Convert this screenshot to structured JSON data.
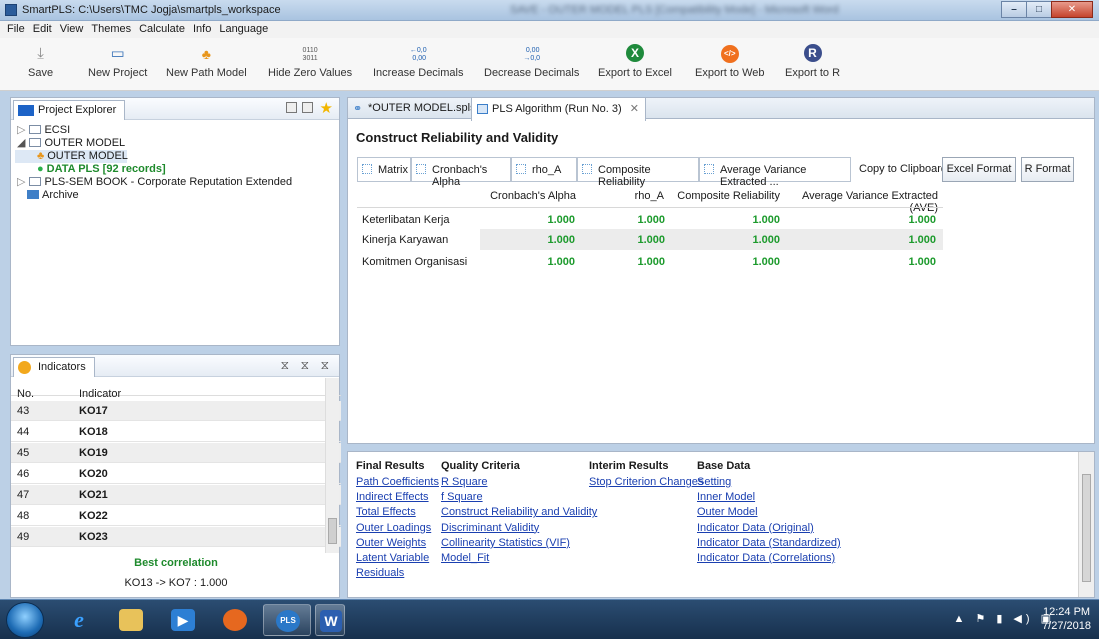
{
  "window": {
    "title": "SmartPLS: C:\\Users\\TMC Jogja\\smartpls_workspace",
    "blurred_title": "SAVE - OUTER MODEL PLS [Compatibility Mode] - Microsoft Word"
  },
  "menu": [
    "File",
    "Edit",
    "View",
    "Themes",
    "Calculate",
    "Info",
    "Language"
  ],
  "toolbar": [
    {
      "label": "Save",
      "icon": "save-icon"
    },
    {
      "label": "New Project",
      "icon": "new-project-icon"
    },
    {
      "label": "New Path Model",
      "icon": "path-model-icon"
    },
    {
      "label": "Hide Zero Values",
      "icon": "binary-icon",
      "glyph": "0110\n3011"
    },
    {
      "label": "Increase Decimals",
      "icon": "increase-decimals-icon",
      "glyph": "←0,0\n0,00"
    },
    {
      "label": "Decrease Decimals",
      "icon": "decrease-decimals-icon",
      "glyph": "0,00\n→0,0"
    },
    {
      "label": "Export to Excel",
      "icon": "excel-icon",
      "glyph": "X"
    },
    {
      "label": "Export to Web",
      "icon": "web-icon",
      "glyph": "</>"
    },
    {
      "label": "Export to R",
      "icon": "r-icon",
      "glyph": "R"
    }
  ],
  "project_explorer": {
    "tab": "Project Explorer",
    "items": [
      {
        "label": "ECSI"
      },
      {
        "label": "OUTER MODEL"
      },
      {
        "label": "OUTER MODEL"
      },
      {
        "label": "DATA PLS [92 records]"
      },
      {
        "label": "PLS-SEM BOOK - Corporate Reputation Extended"
      },
      {
        "label": "Archive"
      }
    ]
  },
  "indicators": {
    "tab": "Indicators",
    "col_no": "No.",
    "col_indicator": "Indicator",
    "rows": [
      {
        "no": "43",
        "name": "KO17"
      },
      {
        "no": "44",
        "name": "KO18"
      },
      {
        "no": "45",
        "name": "KO19"
      },
      {
        "no": "46",
        "name": "KO20"
      },
      {
        "no": "47",
        "name": "KO21"
      },
      {
        "no": "48",
        "name": "KO22"
      },
      {
        "no": "49",
        "name": "KO23"
      }
    ],
    "best_label": "Best correlation",
    "best_value": "KO13 -> KO7 : 1.000"
  },
  "editor_tabs": [
    {
      "label": "*OUTER MODEL.splsm"
    },
    {
      "label": "PLS Algorithm (Run No. 3)"
    }
  ],
  "report": {
    "title": "Construct Reliability and Validity",
    "subtabs": [
      "Matrix",
      "Cronbach's Alpha",
      "rho_A",
      "Composite Reliability",
      "Average Variance Extracted ..."
    ],
    "copy_label": "Copy to Clipboard:",
    "excel_btn": "Excel Format",
    "r_btn": "R Format",
    "columns": [
      "Cronbach's Alpha",
      "rho_A",
      "Composite Reliability",
      "Average Variance Extracted (AVE)"
    ],
    "rows": [
      {
        "name": "Keterlibatan Kerja",
        "values": [
          "1.000",
          "1.000",
          "1.000",
          "1.000"
        ]
      },
      {
        "name": "Kinerja Karyawan",
        "values": [
          "1.000",
          "1.000",
          "1.000",
          "1.000"
        ]
      },
      {
        "name": "Komitmen Organisasi",
        "values": [
          "1.000",
          "1.000",
          "1.000",
          "1.000"
        ]
      }
    ],
    "value_color": "#1c9a2c"
  },
  "links": {
    "final": {
      "heading": "Final Results",
      "items": [
        "Path Coefficients",
        "Indirect Effects",
        "Total Effects",
        "Outer Loadings",
        "Outer Weights",
        "Latent Variable",
        "Residuals"
      ]
    },
    "quality": {
      "heading": "Quality Criteria",
      "items": [
        "R Square",
        "f Square",
        "Construct Reliability and Validity",
        "Discriminant Validity",
        "Collinearity Statistics (VIF)",
        "Model_Fit"
      ]
    },
    "interim": {
      "heading": "Interim Results",
      "items": [
        "Stop Criterion Changes"
      ]
    },
    "base": {
      "heading": "Base Data",
      "items": [
        "Setting",
        "Inner Model",
        "Outer Model",
        "Indicator Data (Original)",
        "Indicator Data (Standardized)",
        "Indicator Data (Correlations)"
      ]
    }
  },
  "taskbar": {
    "time": "12:24 PM",
    "date": "7/27/2018"
  }
}
